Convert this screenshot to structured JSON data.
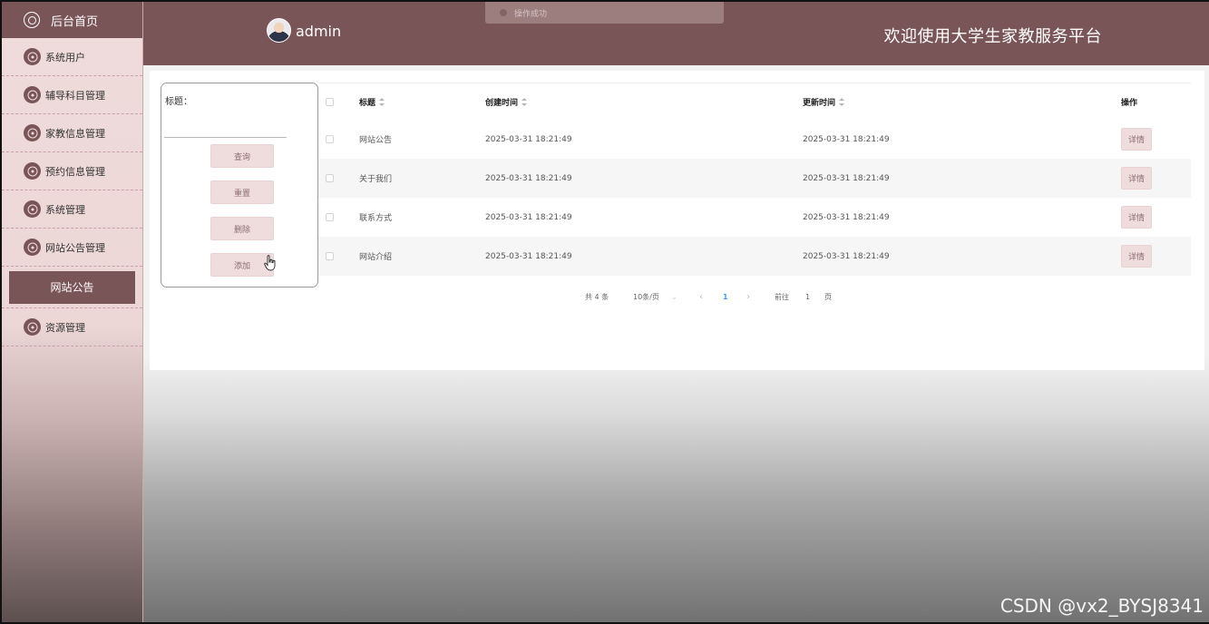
{
  "header": {
    "username": "admin",
    "site_title": "欢迎使用大学生家教服务平台",
    "toast_text": "操作成功"
  },
  "sidebar": {
    "home_label": "后台首页",
    "items": [
      {
        "label": "系统用户",
        "icon": "flower-icon"
      },
      {
        "label": "辅导科目管理",
        "icon": "flower-icon"
      },
      {
        "label": "家教信息管理",
        "icon": "flower-icon"
      },
      {
        "label": "预约信息管理",
        "icon": "flower-icon"
      },
      {
        "label": "系统管理",
        "icon": "flower-icon"
      },
      {
        "label": "网站公告管理",
        "icon": "flower-icon"
      },
      {
        "label": "资源管理",
        "icon": "flower-icon"
      }
    ],
    "active_sub": "网站公告"
  },
  "search": {
    "label": "标题：",
    "input_value": "",
    "buttons": {
      "query": "查询",
      "reset": "重置",
      "delete": "删除",
      "add": "添加"
    }
  },
  "table": {
    "columns": {
      "title": "标题",
      "created": "创建时间",
      "updated": "更新时间",
      "action": "操作"
    },
    "rows": [
      {
        "title": "网站公告",
        "created": "2025-03-31 18:21:49",
        "updated": "2025-03-31 18:21:49",
        "action": "详情"
      },
      {
        "title": "关于我们",
        "created": "2025-03-31 18:21:49",
        "updated": "2025-03-31 18:21:49",
        "action": "详情"
      },
      {
        "title": "联系方式",
        "created": "2025-03-31 18:21:49",
        "updated": "2025-03-31 18:21:49",
        "action": "详情"
      },
      {
        "title": "网站介绍",
        "created": "2025-03-31 18:21:49",
        "updated": "2025-03-31 18:21:49",
        "action": "详情"
      }
    ]
  },
  "pagination": {
    "total": "共 4 条",
    "page_size": "10条/页",
    "current_page": "1",
    "goto_label": "前往",
    "goto_value": "1",
    "page_unit": "页"
  },
  "watermark": "CSDN @vx2_BYSJ8341",
  "colors": {
    "accent": "#7a5558",
    "sidebar_bg": "#f0dcdc",
    "button_bg": "#efdcdc",
    "pager_active": "#409eff"
  }
}
